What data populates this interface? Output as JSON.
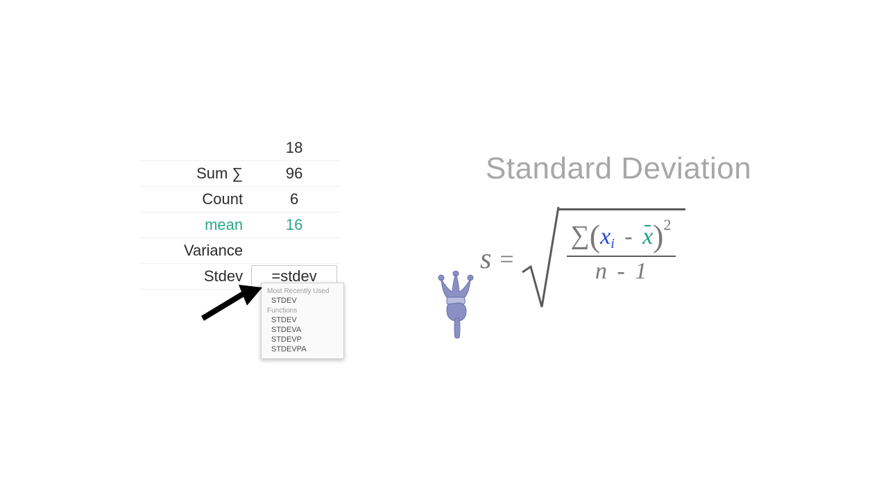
{
  "title": "Standard Deviation",
  "sheet": {
    "rows": [
      {
        "label": "",
        "value": "18",
        "label_class": "",
        "value_class": ""
      },
      {
        "label": "Sum   ∑",
        "value": "96",
        "label_class": "",
        "value_class": ""
      },
      {
        "label": "Count",
        "value": "6",
        "label_class": "",
        "value_class": ""
      },
      {
        "label": "mean",
        "value": "16",
        "label_class": "mean-label",
        "value_class": "mean-value"
      },
      {
        "label": "Variance",
        "value": "",
        "label_class": "",
        "value_class": ""
      },
      {
        "label": "Stdev",
        "value": "",
        "label_class": "",
        "value_class": ""
      }
    ],
    "formula_input": "=stdev"
  },
  "suggest": {
    "header_recent": "Most Recently Used",
    "recent": [
      "STDEV"
    ],
    "header_fn": "Functions",
    "functions": [
      "STDEV",
      "STDEVA",
      "STDEVP",
      "STDEVPA"
    ]
  },
  "formula": {
    "s": "s",
    "eq": "=",
    "sigma": "∑",
    "lparen": "(",
    "x": "x",
    "i": "i",
    "minus": "-",
    "xbar": "x",
    "rparen": ")",
    "sq": "2",
    "n": "n",
    "one": "1"
  },
  "icons": {
    "arrow": "arrow-icon",
    "jester": "jester-hand-icon"
  }
}
